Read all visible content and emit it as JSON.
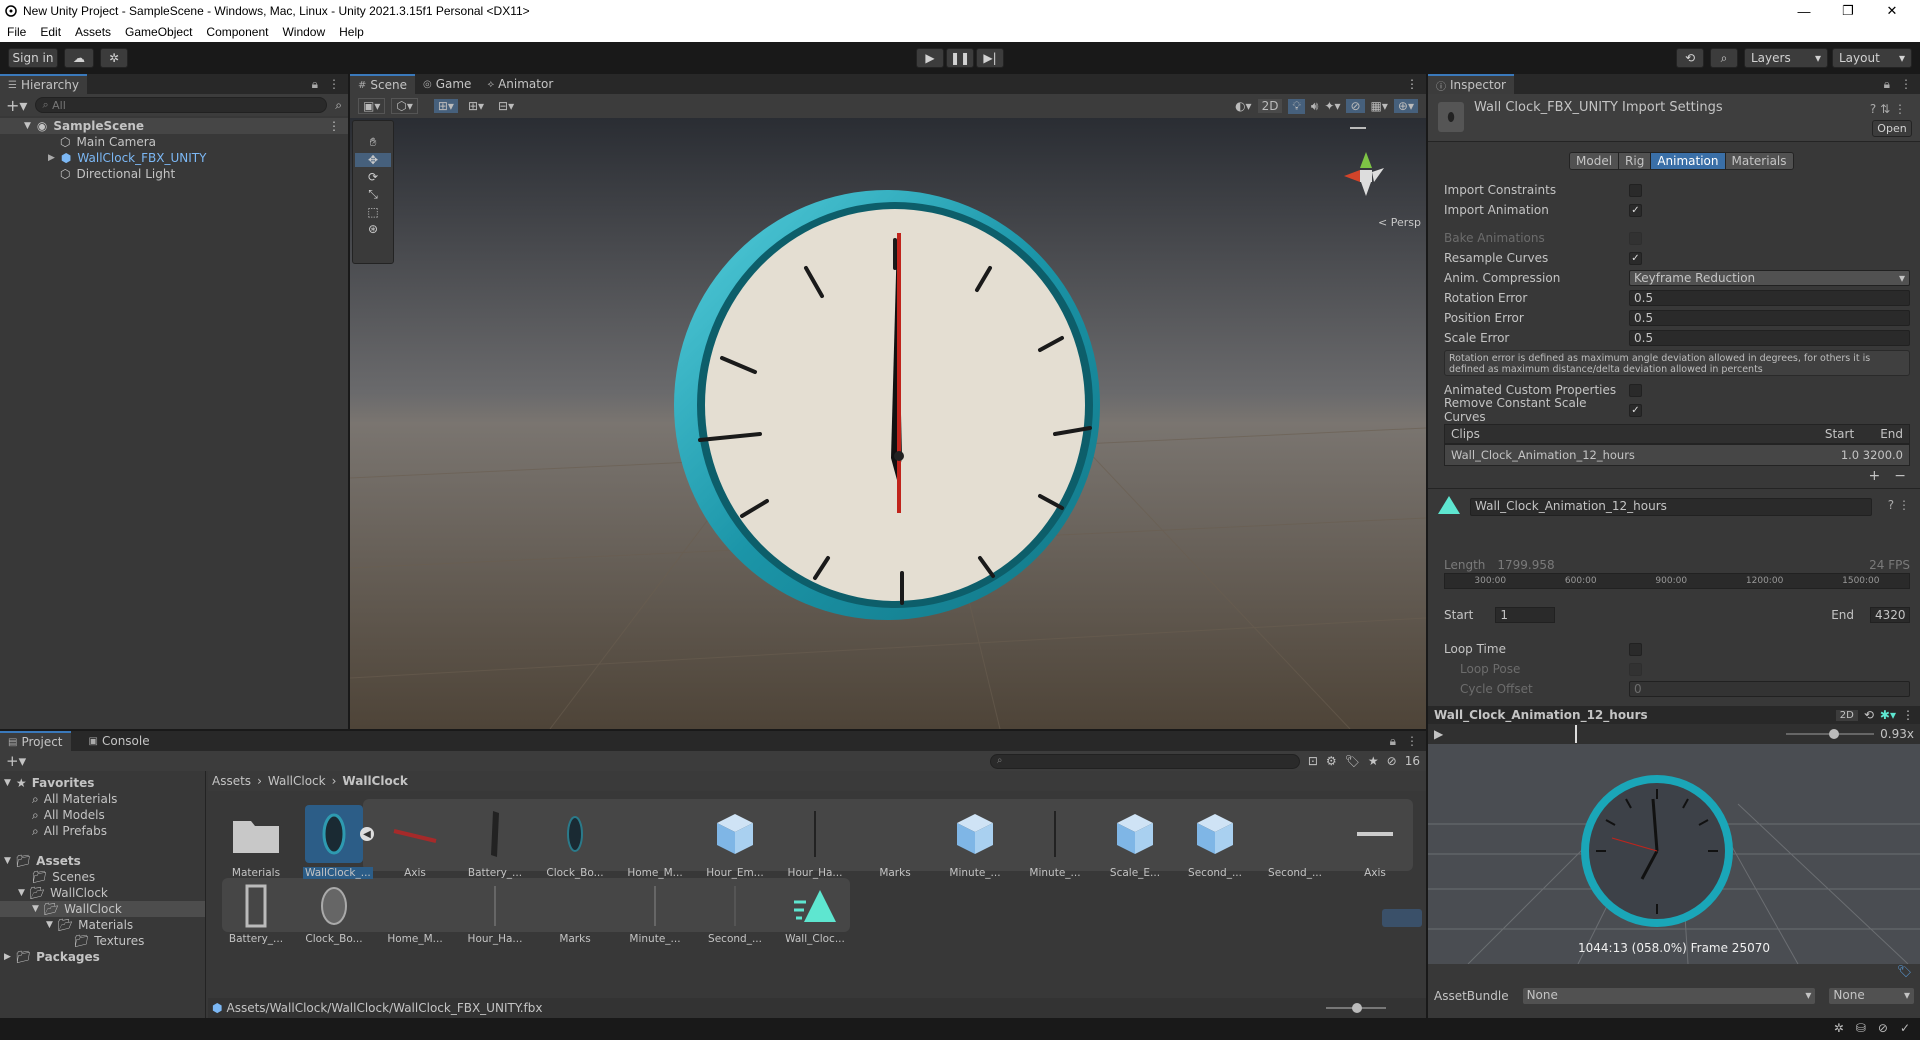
{
  "titlebar": {
    "title": "New Unity Project - SampleScene - Windows, Mac, Linux - Unity 2021.3.15f1 Personal <DX11>"
  },
  "menu": [
    "File",
    "Edit",
    "Assets",
    "GameObject",
    "Component",
    "Window",
    "Help"
  ],
  "toolbar": {
    "sign_in": "Sign in",
    "layers": "Layers",
    "layout": "Layout"
  },
  "hierarchy": {
    "tab": "Hierarchy",
    "search_placeholder": "All",
    "scene": "SampleScene",
    "items": [
      "Main Camera",
      "WallClock_FBX_UNITY",
      "Directional Light"
    ]
  },
  "scene_view": {
    "tabs": [
      "Scene",
      "Game",
      "Animator"
    ],
    "mode_2d": "2D",
    "persp_label": "< Persp"
  },
  "inspector": {
    "tab": "Inspector",
    "header": "Wall Clock_FBX_UNITY Import Settings",
    "open_button": "Open",
    "subtabs": [
      "Model",
      "Rig",
      "Animation",
      "Materials"
    ],
    "rows": [
      {
        "label": "Import Constraints",
        "value": ""
      },
      {
        "label": "Import Animation",
        "value": "✓"
      },
      {
        "label": "Bake Animations",
        "value": ""
      },
      {
        "label": "Resample Curves",
        "value": "✓"
      },
      {
        "label": "Anim. Compression",
        "value": "Keyframe Reduction"
      },
      {
        "label": "Rotation Error",
        "value": "0.5"
      },
      {
        "label": "Position Error",
        "value": "0.5"
      },
      {
        "label": "Scale Error",
        "value": "0.5"
      }
    ],
    "help_text": "Rotation error is defined as maximum angle deviation allowed in degrees, for others it is defined as maximum distance/delta deviation allowed in percents",
    "row_custom_props": "Animated Custom Properties",
    "row_remove_scale": "Remove Constant Scale Curves",
    "remove_scale_check": "✓",
    "clips": {
      "header": "Clips",
      "start_col": "Start",
      "end_col": "End",
      "clip_name": "Wall_Clock_Animation_12_hours",
      "clip_range": "1.0 3200.0",
      "add": "+",
      "remove": "−"
    },
    "clip_editor": {
      "name": "Wall_Clock_Animation_12_hours",
      "length_label": "Length",
      "length": "1799.958",
      "fps": "24 FPS",
      "ticks": [
        "300:00",
        "600:00",
        "900:00",
        "1200:00",
        "1500:00"
      ],
      "start_label": "Start",
      "start_value": "1",
      "end_label": "End",
      "end_value": "4320",
      "loop_time": "Loop Time",
      "loop_pose": "Loop Pose",
      "cycle_offset": "Cycle Offset",
      "cycle_value": "0"
    },
    "preview": {
      "name": "Wall_Clock_Animation_12_hours",
      "mode": "2D",
      "speed": "0.93x",
      "speed_fraction": 0.55,
      "time_label": "1044:13 (058.0%) Frame 25070"
    },
    "assetbundle": {
      "label": "AssetBundle",
      "value": "None",
      "variant": "None"
    }
  },
  "project": {
    "tabs": [
      "Project",
      "Console"
    ],
    "favorites": {
      "label": "Favorites",
      "items": [
        "All Materials",
        "All Models",
        "All Prefabs"
      ]
    },
    "assets_tree": [
      {
        "label": "Assets",
        "indent": 0
      },
      {
        "label": "Scenes",
        "indent": 1
      },
      {
        "label": "WallClock",
        "indent": 1
      },
      {
        "label": "WallClock",
        "indent": 2
      },
      {
        "label": "Materials",
        "indent": 3
      },
      {
        "label": "Textures",
        "indent": 4
      },
      {
        "label": "Packages",
        "indent": 0
      }
    ],
    "breadcrumb": [
      "Assets",
      "WallClock",
      "WallClock"
    ],
    "count": "16",
    "row1": [
      "Materials",
      "WallClock_...",
      "Axis",
      "Battery_...",
      "Clock_Bo...",
      "Home_M...",
      "Hour_Em...",
      "Hour_Ha...",
      "Marks",
      "Minute_...",
      "Minute_...",
      "Scale_E...",
      "Second_...",
      "Second_...",
      "Axis"
    ],
    "row2": [
      "Battery_...",
      "Clock_Bo...",
      "Home_M...",
      "Hour_Ha...",
      "Marks",
      "Minute_...",
      "Second_...",
      "Wall_Cloc..."
    ],
    "path": "Assets/WallClock/WallClock/WallClock_FBX_UNITY.fbx"
  },
  "colors": {
    "accent": "#3a79bb",
    "selection": "#2c5d87",
    "clock_rim": "#1fa6b8",
    "clock_face": "#e4ded2",
    "second_hand": "#c0241c"
  }
}
